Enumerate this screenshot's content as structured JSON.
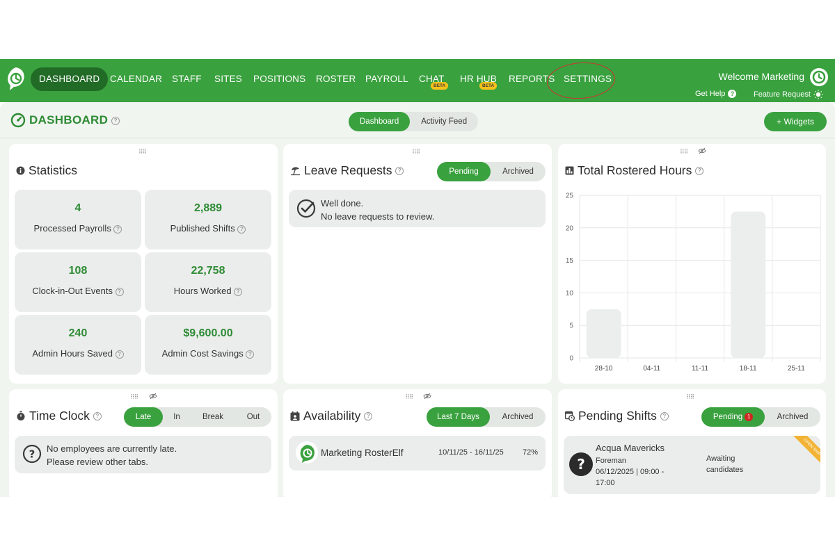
{
  "nav": {
    "items": [
      "DASHBOARD",
      "CALENDAR",
      "STAFF",
      "SITES",
      "POSITIONS",
      "ROSTER",
      "PAYROLL",
      "CHAT",
      "HR HUB",
      "REPORTS",
      "SETTINGS"
    ],
    "beta_label": "BETA",
    "welcome": "Welcome Marketing",
    "get_help": "Get Help",
    "feature_request": "Feature Request"
  },
  "page": {
    "title": "DASHBOARD",
    "view_tabs": [
      "Dashboard",
      "Activity Feed"
    ],
    "widgets_button": "+ Widgets"
  },
  "statistics": {
    "title": "Statistics",
    "tiles": [
      {
        "value": "4",
        "label": "Processed Payrolls"
      },
      {
        "value": "2,889",
        "label": "Published Shifts"
      },
      {
        "value": "108",
        "label": "Clock-in-Out Events"
      },
      {
        "value": "22,758",
        "label": "Hours Worked"
      },
      {
        "value": "240",
        "label": "Admin Hours Saved"
      },
      {
        "value": "$9,600.00",
        "label": "Admin Cost Savings"
      }
    ]
  },
  "leave": {
    "title": "Leave Requests",
    "tabs": [
      "Pending",
      "Archived"
    ],
    "message_line1": "Well done.",
    "message_line2": "No leave requests to review."
  },
  "rostered": {
    "title": "Total Rostered Hours"
  },
  "chart_data": {
    "type": "bar",
    "title": "Total Rostered Hours",
    "categories": [
      "28-10",
      "04-11",
      "11-11",
      "18-11",
      "25-11"
    ],
    "values": [
      7.5,
      0,
      0,
      22.5,
      0
    ],
    "ylim": [
      0,
      25
    ],
    "yticks": [
      0,
      5,
      10,
      15,
      20,
      25
    ],
    "grid": true,
    "bar_color": "#eceeed"
  },
  "timeclock": {
    "title": "Time Clock",
    "tabs": [
      "Late",
      "In",
      "Break",
      "Out"
    ],
    "message_line1": "No employees are currently late.",
    "message_line2": "Please review other tabs."
  },
  "availability": {
    "title": "Availability",
    "tabs": [
      "Last 7 Days",
      "Archived"
    ],
    "rows": [
      {
        "name": "Marketing RosterElf",
        "range": "10/11/25 - 16/11/25",
        "percent": "72%"
      }
    ]
  },
  "pending_shifts": {
    "title": "Pending Shifts",
    "tabs": [
      "Pending",
      "Archived"
    ],
    "pending_count": "1",
    "shift": {
      "site": "Acqua Mavericks",
      "position": "Foreman",
      "when_line1": "06/12/2025 | 09:00 -",
      "when_line2": "17:00",
      "status_line1": "Awaiting",
      "status_line2": "candidates",
      "ribbon": "OPEN SHIFT"
    }
  },
  "colors": {
    "brand_green": "#3aa13f",
    "active_nav": "#226b27",
    "beta_yellow": "#f5c21b",
    "alert_red": "#d0261f"
  }
}
